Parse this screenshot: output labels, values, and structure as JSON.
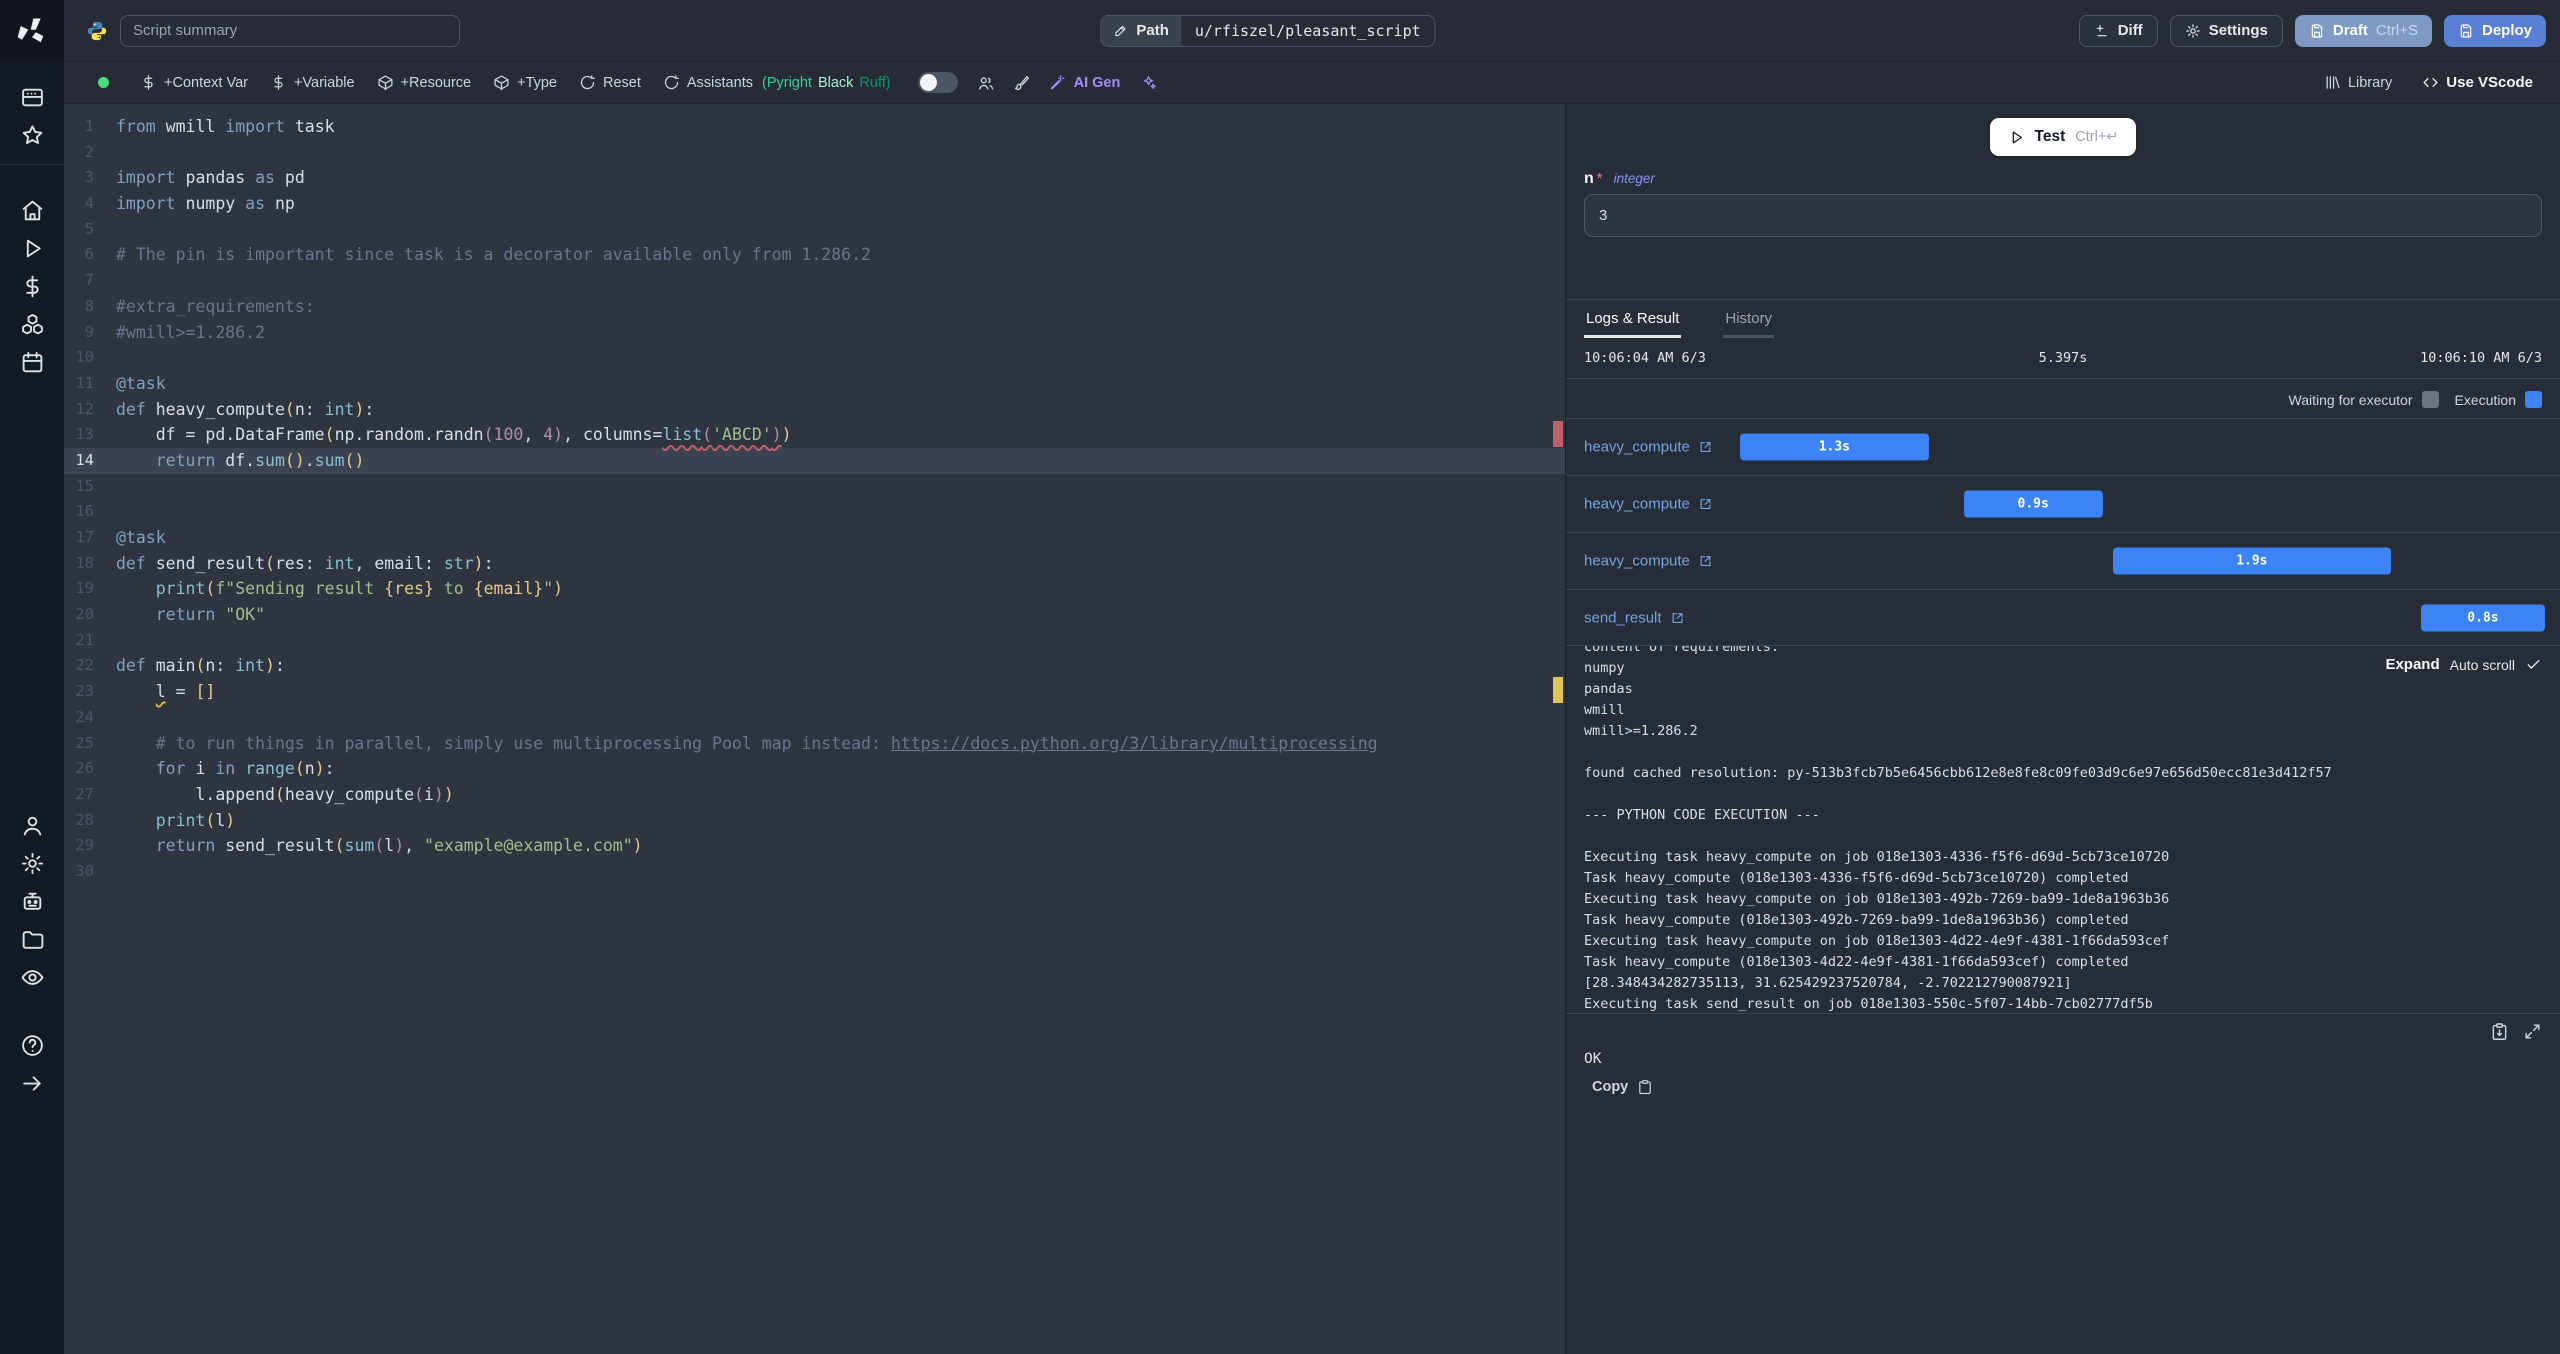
{
  "sidebar": {
    "groups": [
      [
        "app-window",
        "star"
      ],
      [
        "home",
        "play",
        "dollar",
        "boxes",
        "calendar"
      ],
      [
        "user",
        "gear",
        "robot",
        "folder",
        "eye"
      ],
      [
        "help",
        "arrow-right"
      ]
    ]
  },
  "topbar": {
    "summary_placeholder": "Script summary",
    "path_label": "Path",
    "path_value": "u/rfiszel/pleasant_script",
    "diff_label": "Diff",
    "settings_label": "Settings",
    "draft_label": "Draft",
    "draft_shortcut": "Ctrl+S",
    "deploy_label": "Deploy"
  },
  "toolbar": {
    "add_buttons": [
      {
        "icon": "dollar",
        "label": "+Context Var"
      },
      {
        "icon": "dollar",
        "label": "+Variable"
      },
      {
        "icon": "package",
        "label": "+Resource"
      },
      {
        "icon": "package",
        "label": "+Type"
      },
      {
        "icon": "refresh",
        "label": "Reset"
      }
    ],
    "assistants": {
      "icon": "refresh",
      "label": "Assistants",
      "parts": [
        {
          "label": "(Pyright",
          "color": "#34d399"
        },
        {
          "label": "Black",
          "color": "#a7f3d0"
        },
        {
          "label": "Ruff)",
          "color": "#059669"
        }
      ]
    },
    "ai_gen_label": "AI Gen",
    "library_label": "Library",
    "vscode_label": "Use VScode"
  },
  "editor": {
    "active_line": 14,
    "lines": [
      [
        [
          "kw",
          "from"
        ],
        [
          "pl",
          " wmill "
        ],
        [
          "kw",
          "import"
        ],
        [
          "pl",
          " task"
        ]
      ],
      [],
      [
        [
          "kw",
          "import"
        ],
        [
          "pl",
          " pandas "
        ],
        [
          "kw",
          "as"
        ],
        [
          "pl",
          " pd"
        ]
      ],
      [
        [
          "kw",
          "import"
        ],
        [
          "pl",
          " numpy "
        ],
        [
          "kw",
          "as"
        ],
        [
          "pl",
          " np"
        ]
      ],
      [],
      [
        [
          "cm",
          "# The pin is important since task is a decorator available only from 1.286.2"
        ]
      ],
      [],
      [
        [
          "cm",
          "#extra_requirements:"
        ]
      ],
      [
        [
          "cm",
          "#wmill>=1.286.2"
        ]
      ],
      [],
      [
        [
          "kw",
          "@task"
        ]
      ],
      [
        [
          "kw",
          "def"
        ],
        [
          "pl",
          " heavy_compute"
        ],
        [
          "p1",
          "("
        ],
        [
          "pl",
          "n"
        ],
        [
          "pl",
          ": "
        ],
        [
          "ty",
          "int"
        ],
        [
          "p1",
          ")"
        ],
        [
          "pl",
          ":"
        ]
      ],
      [
        [
          "pl",
          "    df = pd.DataFrame"
        ],
        [
          "p1",
          "("
        ],
        [
          "pl",
          "np.random.randn"
        ],
        [
          "p2",
          "("
        ],
        [
          "num",
          "100"
        ],
        [
          "pl",
          ", "
        ],
        [
          "num",
          "4"
        ],
        [
          "p2",
          ")"
        ],
        [
          "pl",
          ", columns="
        ],
        [
          "cy err",
          "list"
        ],
        [
          "p2 err",
          "("
        ],
        [
          "str err",
          "'ABCD'"
        ],
        [
          "p2 err",
          ")"
        ],
        [
          "p1",
          ")"
        ]
      ],
      [
        [
          "pl",
          "    "
        ],
        [
          "kw",
          "return"
        ],
        [
          "pl",
          " df."
        ],
        [
          "cy",
          "sum"
        ],
        [
          "p1",
          "()"
        ],
        [
          "pl",
          "."
        ],
        [
          "cy",
          "sum"
        ],
        [
          "p1",
          "()"
        ]
      ],
      [],
      [],
      [
        [
          "kw",
          "@task"
        ]
      ],
      [
        [
          "kw",
          "def"
        ],
        [
          "pl",
          " send_result"
        ],
        [
          "p1",
          "("
        ],
        [
          "pl",
          "res: "
        ],
        [
          "ty",
          "int"
        ],
        [
          "pl",
          ", email: "
        ],
        [
          "ty",
          "str"
        ],
        [
          "p1",
          ")"
        ],
        [
          "pl",
          ":"
        ]
      ],
      [
        [
          "pl",
          "    "
        ],
        [
          "cy",
          "print"
        ],
        [
          "p1",
          "("
        ],
        [
          "str",
          "f\"Sending result "
        ],
        [
          "br",
          "{res}"
        ],
        [
          "str",
          " to "
        ],
        [
          "br",
          "{email}"
        ],
        [
          "str",
          "\""
        ],
        [
          "p1",
          ")"
        ]
      ],
      [
        [
          "pl",
          "    "
        ],
        [
          "kw",
          "return"
        ],
        [
          "pl",
          " "
        ],
        [
          "str",
          "\"OK\""
        ]
      ],
      [],
      [
        [
          "kw",
          "def"
        ],
        [
          "pl",
          " main"
        ],
        [
          "p1",
          "("
        ],
        [
          "pl",
          "n: "
        ],
        [
          "ty",
          "int"
        ],
        [
          "p1",
          ")"
        ],
        [
          "pl",
          ":"
        ]
      ],
      [
        [
          "pl",
          "    "
        ],
        [
          "warn",
          "l"
        ],
        [
          "pl",
          " = "
        ],
        [
          "p1",
          "[]"
        ]
      ],
      [],
      [
        [
          "cm",
          "    # to run things in parallel, simply use multiprocessing Pool map instead: "
        ],
        [
          "url",
          "https://docs.python.org/3/library/multiprocessing"
        ]
      ],
      [
        [
          "pl",
          "    "
        ],
        [
          "kw",
          "for"
        ],
        [
          "pl",
          " i "
        ],
        [
          "kw",
          "in"
        ],
        [
          "pl",
          " "
        ],
        [
          "cy",
          "range"
        ],
        [
          "p1",
          "("
        ],
        [
          "pl",
          "n"
        ],
        [
          "p1",
          ")"
        ],
        [
          "pl",
          ":"
        ]
      ],
      [
        [
          "pl",
          "        l.append"
        ],
        [
          "p1",
          "("
        ],
        [
          "pl",
          "heavy_compute"
        ],
        [
          "p2",
          "("
        ],
        [
          "pl",
          "i"
        ],
        [
          "p2",
          ")"
        ],
        [
          "p1",
          ")"
        ]
      ],
      [
        [
          "pl",
          "    "
        ],
        [
          "cy",
          "print"
        ],
        [
          "p1",
          "("
        ],
        [
          "pl",
          "l"
        ],
        [
          "p1",
          ")"
        ]
      ],
      [
        [
          "pl",
          "    "
        ],
        [
          "kw",
          "return"
        ],
        [
          "pl",
          " send_result"
        ],
        [
          "p1",
          "("
        ],
        [
          "cy",
          "sum"
        ],
        [
          "p2",
          "("
        ],
        [
          "pl",
          "l"
        ],
        [
          "p2",
          ")"
        ],
        [
          "pl",
          ", "
        ],
        [
          "str",
          "\"example@example.com\""
        ],
        [
          "p1",
          ")"
        ]
      ],
      []
    ]
  },
  "run_panel": {
    "test_label": "Test",
    "test_shortcut": "Ctrl+↵",
    "arg": {
      "name": "n",
      "required": "*",
      "type": "integer",
      "value": "3"
    },
    "tabs": [
      "Logs & Result",
      "History"
    ],
    "start_time": "10:06:04 AM 6/3",
    "duration": "5.397s",
    "end_time": "10:06:10 AM 6/3",
    "legend": [
      {
        "label": "Waiting for executor",
        "color": "#6b7280"
      },
      {
        "label": "Execution",
        "color": "#3c83f6"
      }
    ],
    "timeline": [
      {
        "label": "heavy_compute",
        "duration": "1.3s",
        "left_pct": 17.5,
        "width_pct": 19
      },
      {
        "label": "heavy_compute",
        "duration": "0.9s",
        "left_pct": 40,
        "width_pct": 14
      },
      {
        "label": "heavy_compute",
        "duration": "1.9s",
        "left_pct": 55,
        "width_pct": 28
      },
      {
        "label": "send_result",
        "duration": "0.8s",
        "left_pct": 86,
        "width_pct": 12.5
      }
    ],
    "logs_controls": {
      "expand": "Expand",
      "autoscroll": "Auto scroll"
    },
    "logs": [
      "content of requirements:",
      "numpy",
      "pandas",
      "wmill",
      "wmill>=1.286.2",
      "",
      "found cached resolution: py-513b3fcb7b5e6456cbb612e8e8fe8c09fe03d9c6e97e656d50ecc81e3d412f57",
      "",
      "--- PYTHON CODE EXECUTION ---",
      "",
      "Executing task heavy_compute on job 018e1303-4336-f5f6-d69d-5cb73ce10720",
      "Task heavy_compute (018e1303-4336-f5f6-d69d-5cb73ce10720) completed",
      "Executing task heavy_compute on job 018e1303-492b-7269-ba99-1de8a1963b36",
      "Task heavy_compute (018e1303-492b-7269-ba99-1de8a1963b36) completed",
      "Executing task heavy_compute on job 018e1303-4d22-4e9f-4381-1f66da593cef",
      "Task heavy_compute (018e1303-4d22-4e9f-4381-1f66da593cef) completed",
      "[28.348434282735113, 31.625429237520784, -2.702212790087921]",
      "Executing task send_result on job 018e1303-550c-5f07-14bb-7cb02777df5b"
    ],
    "result_value": "OK",
    "copy_label": "Copy"
  }
}
